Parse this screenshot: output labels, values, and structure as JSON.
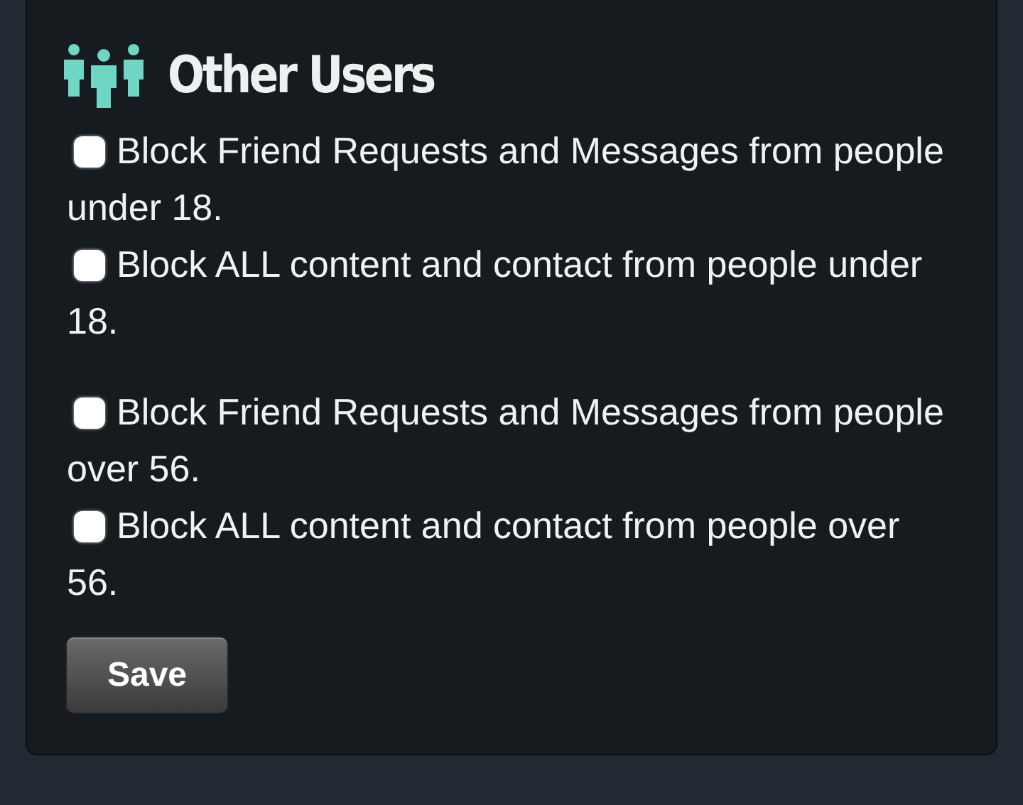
{
  "section": {
    "title": "Other Users"
  },
  "groups": [
    {
      "options": [
        {
          "label": "Block Friend Requests and Messages from people under 18.",
          "checked": false
        },
        {
          "label": "Block ALL content and contact from people under 18.",
          "checked": false
        }
      ]
    },
    {
      "options": [
        {
          "label": "Block Friend Requests and Messages from people over 56.",
          "checked": false
        },
        {
          "label": "Block ALL content and contact from people over 56.",
          "checked": false
        }
      ]
    }
  ],
  "save_button": {
    "label": "Save"
  }
}
